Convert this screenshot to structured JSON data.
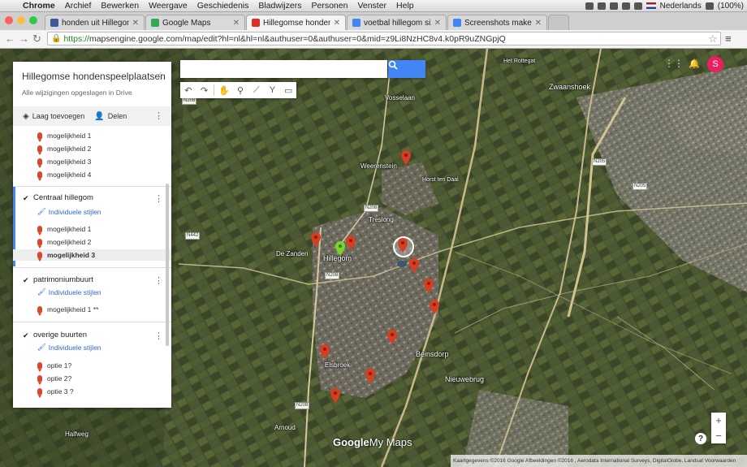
{
  "menubar": {
    "app": "Chrome",
    "items": [
      "Archief",
      "Bewerken",
      "Weergave",
      "Geschiedenis",
      "Bladwijzers",
      "Personen",
      "Venster",
      "Help"
    ],
    "language": "Nederlands",
    "battery": "(100%)"
  },
  "tabs": [
    {
      "label": "honden uit Hillegom",
      "favicon_color": "#3b5998"
    },
    {
      "label": "Google Maps",
      "favicon_color": "#34a853"
    },
    {
      "label": "Hillegomse hondenspeelp…",
      "favicon_color": "#d93025"
    },
    {
      "label": "voetbal hillegom sizo term…",
      "favicon_color": "#4285f4"
    },
    {
      "label": "Screenshots maken op je…",
      "favicon_color": "#4285f4"
    }
  ],
  "address": {
    "scheme": "https://",
    "rest": "mapsengine.google.com/map/edit?hl=nl&hl=nl&authuser=0&authuser=0&mid=z9Li8NzHC8v4.k0pR9uZNGpjQ"
  },
  "search": {
    "placeholder": ""
  },
  "panel": {
    "title": "Hillegomse hondenspeelplaatsen",
    "saved": "Alle wijzigingen opgeslagen in Drive",
    "add_layer": "Laag toevoegen",
    "share": "Delen",
    "untitled_items": [
      "mogelijkheid 1",
      "mogelijkheid 2",
      "mogelijkheid 3",
      "mogelijkheid 4"
    ],
    "layers": [
      {
        "name": "Centraal hillegom",
        "style": "Individuele stijlen",
        "items": [
          "mogelijkheid 1",
          "mogelijkheid 2",
          "mogelijkheid 3"
        ]
      },
      {
        "name": "patrimoniumbuurt",
        "style": "Individuele stijlen",
        "items": [
          "mogelijkheid 1 **"
        ]
      },
      {
        "name": "overige buurten",
        "style": "Individuele stijlen",
        "items": [
          "optie 1?",
          "optie 2?",
          "optie 3 ?"
        ]
      }
    ]
  },
  "map": {
    "places": [
      "Zwaanshoek",
      "Beinsdorp",
      "Nieuwebrug",
      "Weerenstein",
      "Hillegom",
      "De Zanden",
      "Elsbroek",
      "Horst ten Daal",
      "Treslong",
      "Halfweg",
      "Arnoud",
      "Vosselaan",
      "Het Rottegat"
    ],
    "road_labels": [
      "N208",
      "N208",
      "N208",
      "N208",
      "N442",
      "N205",
      "N205"
    ],
    "logo_google": "Google",
    "logo_mymaps": "My Maps",
    "attribution": "Kaartgegevens ©2016 Google Afbeeldingen ©2016 , Aerodata International Surveys, DigitalGlobe, Landsat    Voorwaarden",
    "zoom_in": "+",
    "zoom_out": "−",
    "help": "?",
    "avatar": "S"
  }
}
